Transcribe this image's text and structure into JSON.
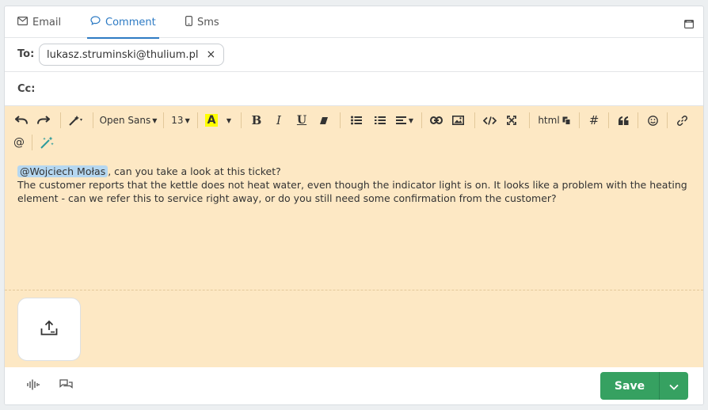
{
  "tabs": [
    {
      "label": "Email",
      "icon": "envelope-icon"
    },
    {
      "label": "Comment",
      "icon": "comment-icon",
      "active": true
    },
    {
      "label": "Sms",
      "icon": "phone-icon"
    }
  ],
  "recipients": {
    "to_label": "To:",
    "to_email": "lukasz.struminski@thulium.pl",
    "remove_symbol": "×",
    "cc_label": "Cc:"
  },
  "toolbar": {
    "font_name": "Open Sans",
    "font_size": "13",
    "highlight_label": "A",
    "bold_label": "B",
    "italic_label": "I",
    "underline_label": "U",
    "html_label": "html",
    "hash_label": "#",
    "at_label": "@",
    "highlight_color": "#ffff00"
  },
  "message": {
    "mention": "@Wojciech Mołas",
    "line1_rest": ", can you take a look at this ticket?",
    "body": "The customer reports that the kettle does not heat water, even though the indicator light is on. It looks like a problem with the heating element - can we refer this to service right away, or do you still need some confirmation from the customer?"
  },
  "footer": {
    "save_label": "Save"
  },
  "colors": {
    "accent": "#2e7bc4",
    "editor_bg": "#fde8c4",
    "save_green": "#36a161",
    "mention_bg": "#b5d7f0"
  }
}
